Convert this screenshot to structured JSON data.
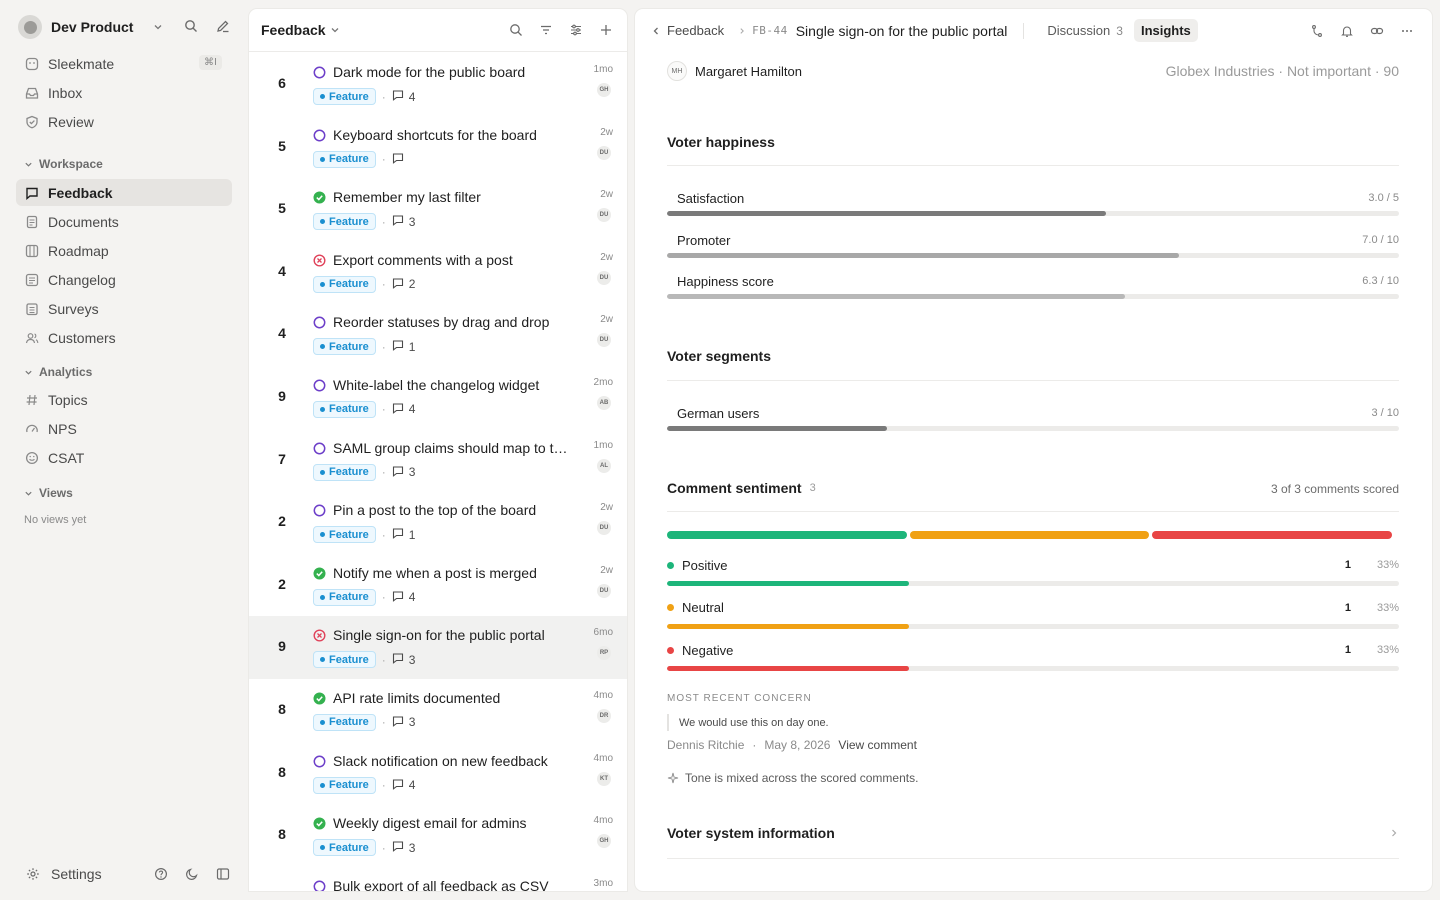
{
  "workspace": {
    "name": "Dev Product"
  },
  "sidebar": {
    "top_items": [
      {
        "label": "Sleekmate",
        "icon": "sparkle-icon",
        "shortcut": "⌘I"
      },
      {
        "label": "Inbox",
        "icon": "inbox-icon"
      },
      {
        "label": "Review",
        "icon": "shield-check-icon"
      }
    ],
    "workspace_section": "Workspace",
    "workspace_items": [
      {
        "label": "Feedback",
        "icon": "message-square-icon",
        "active": true
      },
      {
        "label": "Documents",
        "icon": "document-icon"
      },
      {
        "label": "Roadmap",
        "icon": "roadmap-icon"
      },
      {
        "label": "Changelog",
        "icon": "changelog-icon"
      },
      {
        "label": "Surveys",
        "icon": "survey-icon"
      },
      {
        "label": "Customers",
        "icon": "users-icon"
      }
    ],
    "analytics_section": "Analytics",
    "analytics_items": [
      {
        "label": "Topics",
        "icon": "hash-icon"
      },
      {
        "label": "NPS",
        "icon": "gauge-icon"
      },
      {
        "label": "CSAT",
        "icon": "smile-icon"
      }
    ],
    "views_section": "Views",
    "views_empty": "No views yet",
    "settings_label": "Settings"
  },
  "list": {
    "title": "Feedback",
    "tag_label": "Feature",
    "posts": [
      {
        "votes": "6",
        "title": "Dark mode for the public board",
        "status": "open",
        "comments": "4",
        "age": "1mo",
        "avatar": "GH"
      },
      {
        "votes": "5",
        "title": "Keyboard shortcuts for the board",
        "status": "open",
        "comments": "",
        "age": "2w",
        "avatar": "DU"
      },
      {
        "votes": "5",
        "title": "Remember my last filter",
        "status": "done",
        "comments": "3",
        "age": "2w",
        "avatar": "DU"
      },
      {
        "votes": "4",
        "title": "Export comments with a post",
        "status": "declined",
        "comments": "2",
        "age": "2w",
        "avatar": "DU"
      },
      {
        "votes": "4",
        "title": "Reorder statuses by drag and drop",
        "status": "open",
        "comments": "1",
        "age": "2w",
        "avatar": "DU"
      },
      {
        "votes": "9",
        "title": "White-label the changelog widget",
        "status": "open",
        "comments": "4",
        "age": "2mo",
        "avatar": "AB"
      },
      {
        "votes": "7",
        "title": "SAML group claims should map to teams",
        "status": "open",
        "comments": "3",
        "age": "1mo",
        "avatar": "AL"
      },
      {
        "votes": "2",
        "title": "Pin a post to the top of the board",
        "status": "open",
        "comments": "1",
        "age": "2w",
        "avatar": "DU"
      },
      {
        "votes": "2",
        "title": "Notify me when a post is merged",
        "status": "done",
        "comments": "4",
        "age": "2w",
        "avatar": "DU"
      },
      {
        "votes": "9",
        "title": "Single sign-on for the public portal",
        "status": "declined",
        "comments": "3",
        "age": "6mo",
        "avatar": "RP",
        "selected": true
      },
      {
        "votes": "8",
        "title": "API rate limits documented",
        "status": "done",
        "comments": "3",
        "age": "4mo",
        "avatar": "DR"
      },
      {
        "votes": "8",
        "title": "Slack notification on new feedback",
        "status": "open",
        "comments": "4",
        "age": "4mo",
        "avatar": "KT"
      },
      {
        "votes": "8",
        "title": "Weekly digest email for admins",
        "status": "done",
        "comments": "3",
        "age": "4mo",
        "avatar": "GH"
      },
      {
        "votes": "",
        "title": "Bulk export of all feedback as CSV",
        "status": "open",
        "comments": "",
        "age": "3mo",
        "avatar": ""
      }
    ]
  },
  "detail": {
    "breadcrumb_back": "Feedback",
    "post_id": "FB-44",
    "post_title": "Single sign-on for the public portal",
    "tabs": [
      {
        "label": "Discussion",
        "count": "3",
        "active": false
      },
      {
        "label": "Insights",
        "count": "",
        "active": true
      }
    ],
    "voter": {
      "initials": "MH",
      "name": "Margaret Hamilton",
      "org": "Globex Industries · Not important · 90"
    },
    "happiness": {
      "title": "Voter happiness",
      "metrics": [
        {
          "label": "Satisfaction",
          "value": "3.0 / 5",
          "fraction": 0.6,
          "color": "#7a7a7a"
        },
        {
          "label": "Promoter",
          "value": "7.0 / 10",
          "fraction": 0.7,
          "color": "#a8a8a8"
        },
        {
          "label": "Happiness score",
          "value": "6.3 / 10",
          "fraction": 0.625,
          "color": "#b8b8b8"
        }
      ]
    },
    "segments": {
      "title": "Voter segments",
      "items": [
        {
          "label": "German users",
          "value": "3 / 10",
          "fraction": 0.3,
          "color": "#7a7a7a"
        }
      ]
    },
    "sentiment": {
      "title": "Comment sentiment",
      "count": "3",
      "scored": "3 of 3 comments scored",
      "items": [
        {
          "label": "Positive",
          "count": "1",
          "pct": "33%",
          "fraction": 0.33,
          "color": "#1db57a"
        },
        {
          "label": "Neutral",
          "count": "1",
          "pct": "33%",
          "fraction": 0.33,
          "color": "#f0a114"
        },
        {
          "label": "Negative",
          "count": "1",
          "pct": "33%",
          "fraction": 0.33,
          "color": "#e84545"
        }
      ],
      "concern_heading": "MOST RECENT CONCERN",
      "concern_quote": "We would use this on day one.",
      "concern_author": "Dennis Ritchie",
      "concern_date": "May 8, 2026",
      "concern_link": "View comment",
      "tone": "Tone is mixed across the scored comments."
    },
    "system_info_title": "Voter system information"
  }
}
